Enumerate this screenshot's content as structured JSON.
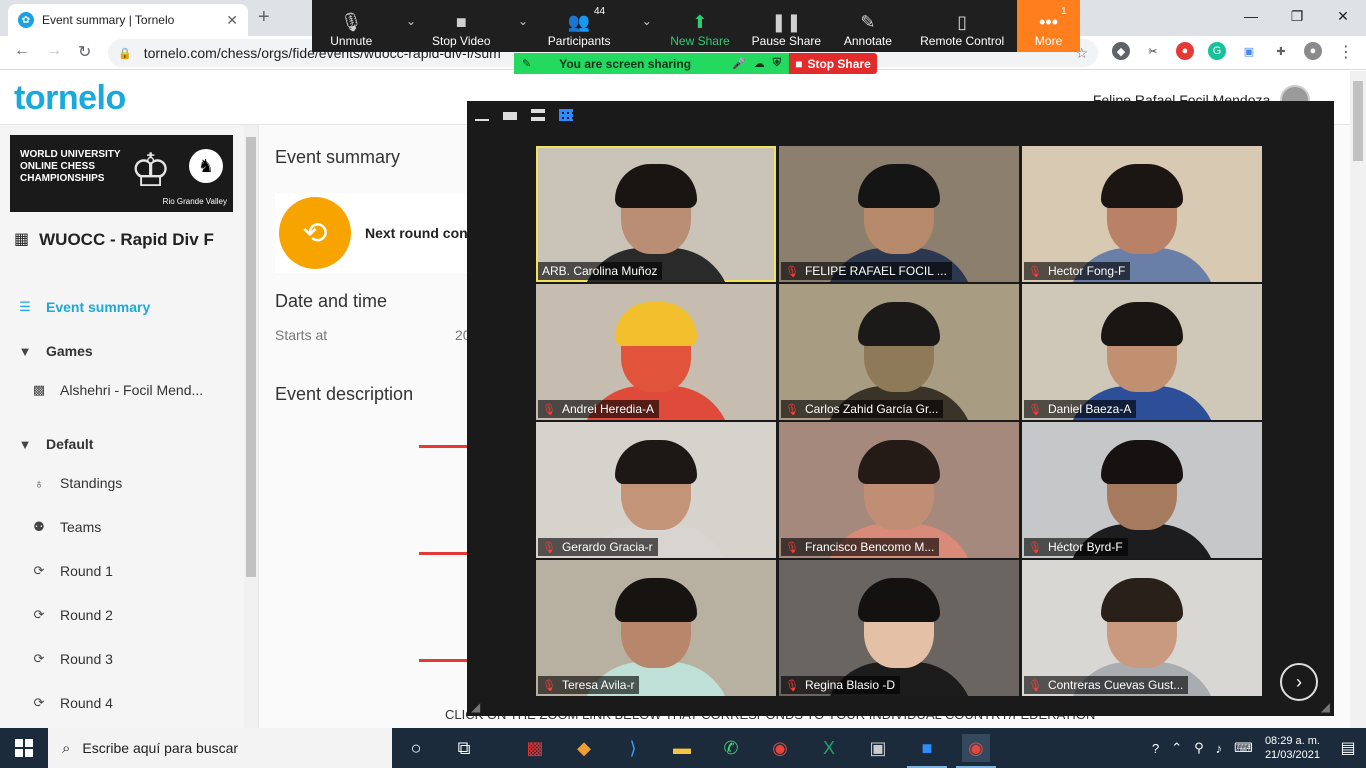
{
  "browser": {
    "tab_title": "Event summary | Tornelo",
    "tab_close": "✕",
    "new_tab": "+",
    "url": "tornelo.com/chess/orgs/fide/events/wuocc-rapid-div-f/sum"
  },
  "zoom_toolbar": {
    "unmute": "Unmute",
    "stop_video": "Stop Video",
    "participants": "Participants",
    "participants_count": "44",
    "new_share": "New Share",
    "pause_share": "Pause Share",
    "annotate": "Annotate",
    "remote_control": "Remote Control",
    "more": "More",
    "more_badge": "1",
    "sharing_status": "You are screen sharing",
    "stop_share": "Stop Share"
  },
  "site": {
    "logo": "tornelo",
    "user_name": "Felipe Rafael Focil Mendoza",
    "banner_title": "WORLD UNIVERSITY ONLINE CHESS CHAMPIONSHIPS",
    "banner_sponsor": "Rio Grande Valley"
  },
  "sidebar": {
    "event_title": "WUOCC - Rapid Div F",
    "event_summary": "Event summary",
    "games_header": "Games",
    "game_item": "Alshehri - Focil Mend...",
    "default_header": "Default",
    "standings": "Standings",
    "teams": "Teams",
    "round1": "Round 1",
    "round2": "Round 2",
    "round3": "Round 3",
    "round4": "Round 4"
  },
  "main": {
    "heading": "Event summary",
    "next_round": "Next round con",
    "date_time": "Date and time",
    "starts_at": "Starts at",
    "starts_value": "20",
    "event_description": "Event description",
    "click_text": "CLICK ON THE ZOOM LINK BELOW THAT CORRESPONDS TO YOUR INDIVIDUAL COUNTRY/FEDERATION"
  },
  "participants": [
    {
      "name": "ARB. Carolina Muñoz",
      "muted": false,
      "active": true,
      "bg": "#c9c3b8",
      "skin": "#b98e74",
      "hair": "#1a1512",
      "shirt": "#2a2a2a"
    },
    {
      "name": "FELIPE RAFAEL FOCIL ...",
      "muted": true,
      "active": false,
      "bg": "#8d7f6d",
      "skin": "#b88a6c",
      "hair": "#151515",
      "shirt": "#2b3850"
    },
    {
      "name": "Hector Fong-F",
      "muted": true,
      "active": false,
      "bg": "#d8c9b2",
      "skin": "#b98266",
      "hair": "#1b1613",
      "shirt": "#6a7fa8"
    },
    {
      "name": "Andrei Heredia-A",
      "muted": true,
      "active": false,
      "bg": "#c6bdb0",
      "skin": "#e2533b",
      "hair": "#f2c02c",
      "shirt": "#e04a3b"
    },
    {
      "name": "Carlos Zahid García Gr...",
      "muted": true,
      "active": false,
      "bg": "#a89c82",
      "skin": "#8e7a58",
      "hair": "#1b1a18",
      "shirt": "#3a3428"
    },
    {
      "name": "Daniel Baeza-A",
      "muted": true,
      "active": false,
      "bg": "#cfc8b8",
      "skin": "#c09070",
      "hair": "#1a1614",
      "shirt": "#2d4f9a"
    },
    {
      "name": "Gerardo Gracia-r",
      "muted": true,
      "active": false,
      "bg": "#d6d2cc",
      "skin": "#c49478",
      "hair": "#1d1815",
      "shirt": "#d8d4d0"
    },
    {
      "name": "Francisco Bencomo M...",
      "muted": true,
      "active": false,
      "bg": "#a5897c",
      "skin": "#c08e74",
      "hair": "#241b16",
      "shirt": "#d98a78"
    },
    {
      "name": "Héctor Byrd-F",
      "muted": true,
      "active": false,
      "bg": "#c5c7c9",
      "skin": "#a57a5e",
      "hair": "#151211",
      "shirt": "#1d1d1f"
    },
    {
      "name": "Teresa Avila-r",
      "muted": true,
      "active": false,
      "bg": "#b8b0a0",
      "skin": "#b8876b",
      "hair": "#171310",
      "shirt": "#bfe0d6"
    },
    {
      "name": "Regina Blasio -D",
      "muted": true,
      "active": false,
      "bg": "#6a6560",
      "skin": "#e3c0a6",
      "hair": "#141210",
      "shirt": "#1d1c1c"
    },
    {
      "name": "Contreras Cuevas Gust...",
      "muted": true,
      "active": false,
      "bg": "#d9d7d3",
      "skin": "#c99a80",
      "hair": "#2a201a",
      "shirt": "#a9adb2"
    }
  ],
  "taskbar": {
    "search_placeholder": "Escribe aquí para buscar",
    "time": "08:29 a. m.",
    "date": "21/03/2021"
  }
}
